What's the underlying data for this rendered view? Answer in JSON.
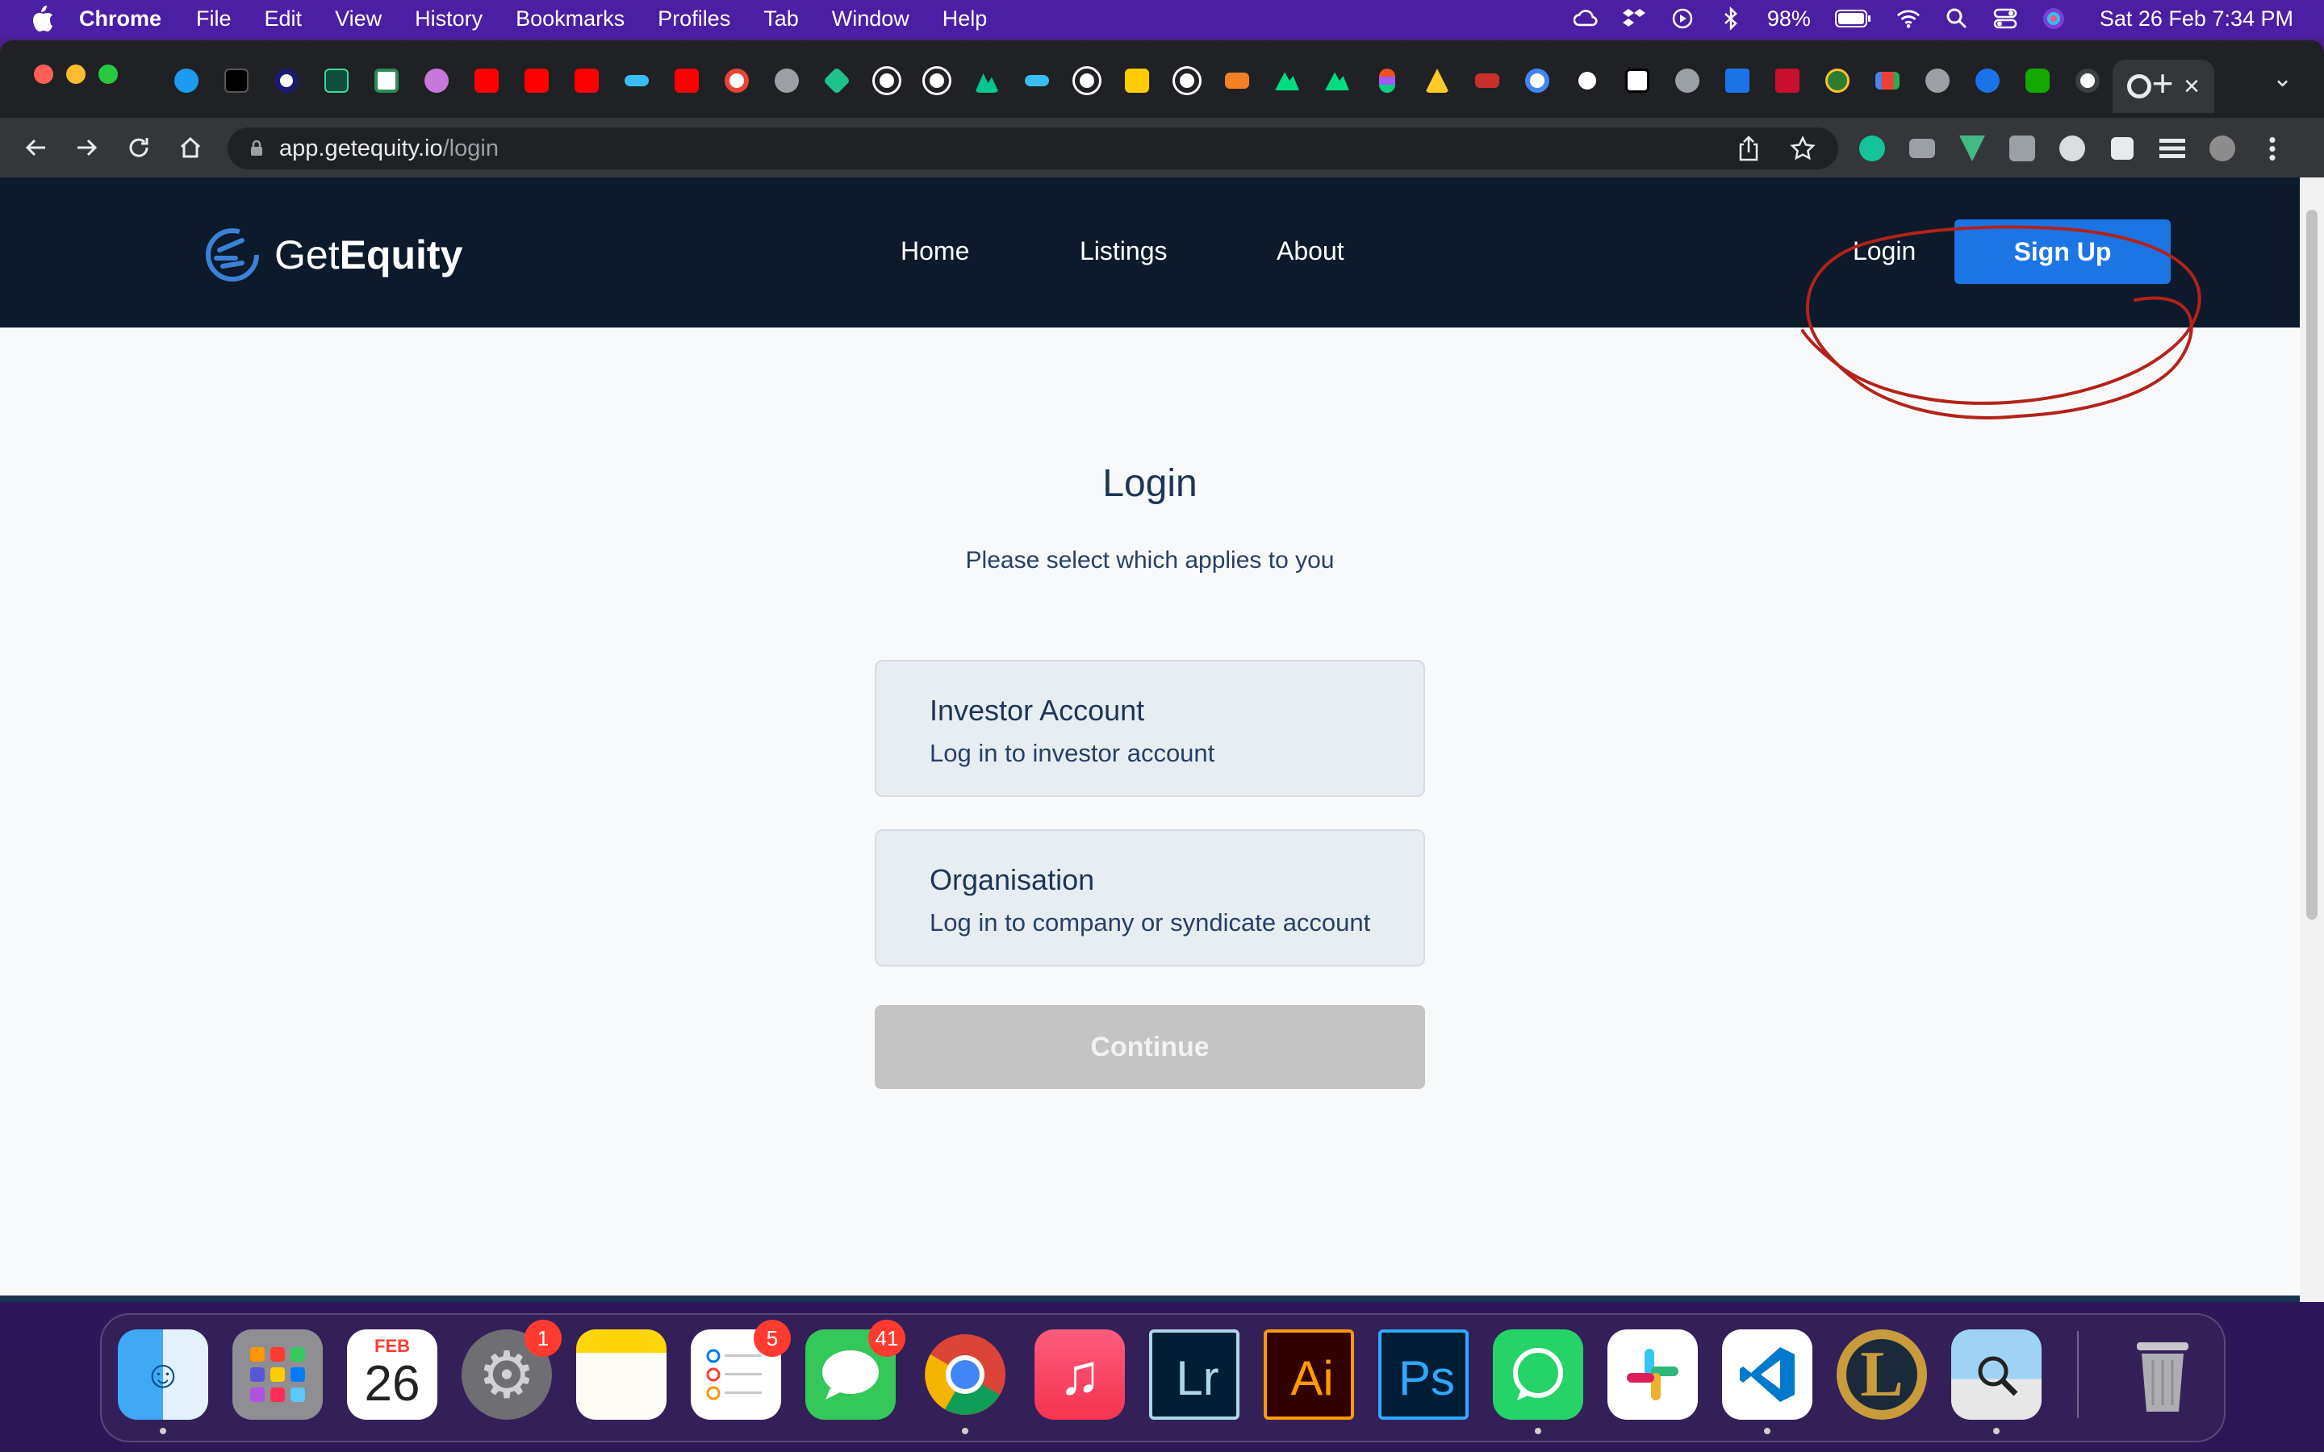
{
  "menubar": {
    "app_name": "Chrome",
    "menus": [
      "File",
      "Edit",
      "View",
      "History",
      "Bookmarks",
      "Profiles",
      "Tab",
      "Window",
      "Help"
    ],
    "battery": "98%",
    "datetime": "Sat 26 Feb  7:34 PM"
  },
  "browser": {
    "url_host": "app.getequity.io",
    "url_path": "/login"
  },
  "site": {
    "logo_text_light": "Get",
    "logo_text_bold": "Equity",
    "nav": {
      "home": "Home",
      "listings": "Listings",
      "about": "About",
      "login": "Login",
      "signup": "Sign Up"
    },
    "annotation_color": "#b3221b"
  },
  "login": {
    "title": "Login",
    "subtitle": "Please select which applies to you",
    "options": [
      {
        "title": "Investor Account",
        "subtitle": "Log in to investor account"
      },
      {
        "title": "Organisation",
        "subtitle": "Log in to company or syndicate account"
      }
    ],
    "continue_label": "Continue"
  },
  "dock": {
    "calendar_month": "FEB",
    "calendar_day": "26",
    "badges": {
      "system_preferences": "1",
      "reminders": "5",
      "messages": "41"
    },
    "lightroom": "Lr",
    "illustrator": "Ai",
    "photoshop": "Ps"
  },
  "colors": {
    "nav_bg": "#0c1a2b",
    "primary": "#1c75e5",
    "card_bg": "#e8edf2",
    "disabled_button": "#c4c4c4",
    "text_dark": "#1d3557"
  }
}
